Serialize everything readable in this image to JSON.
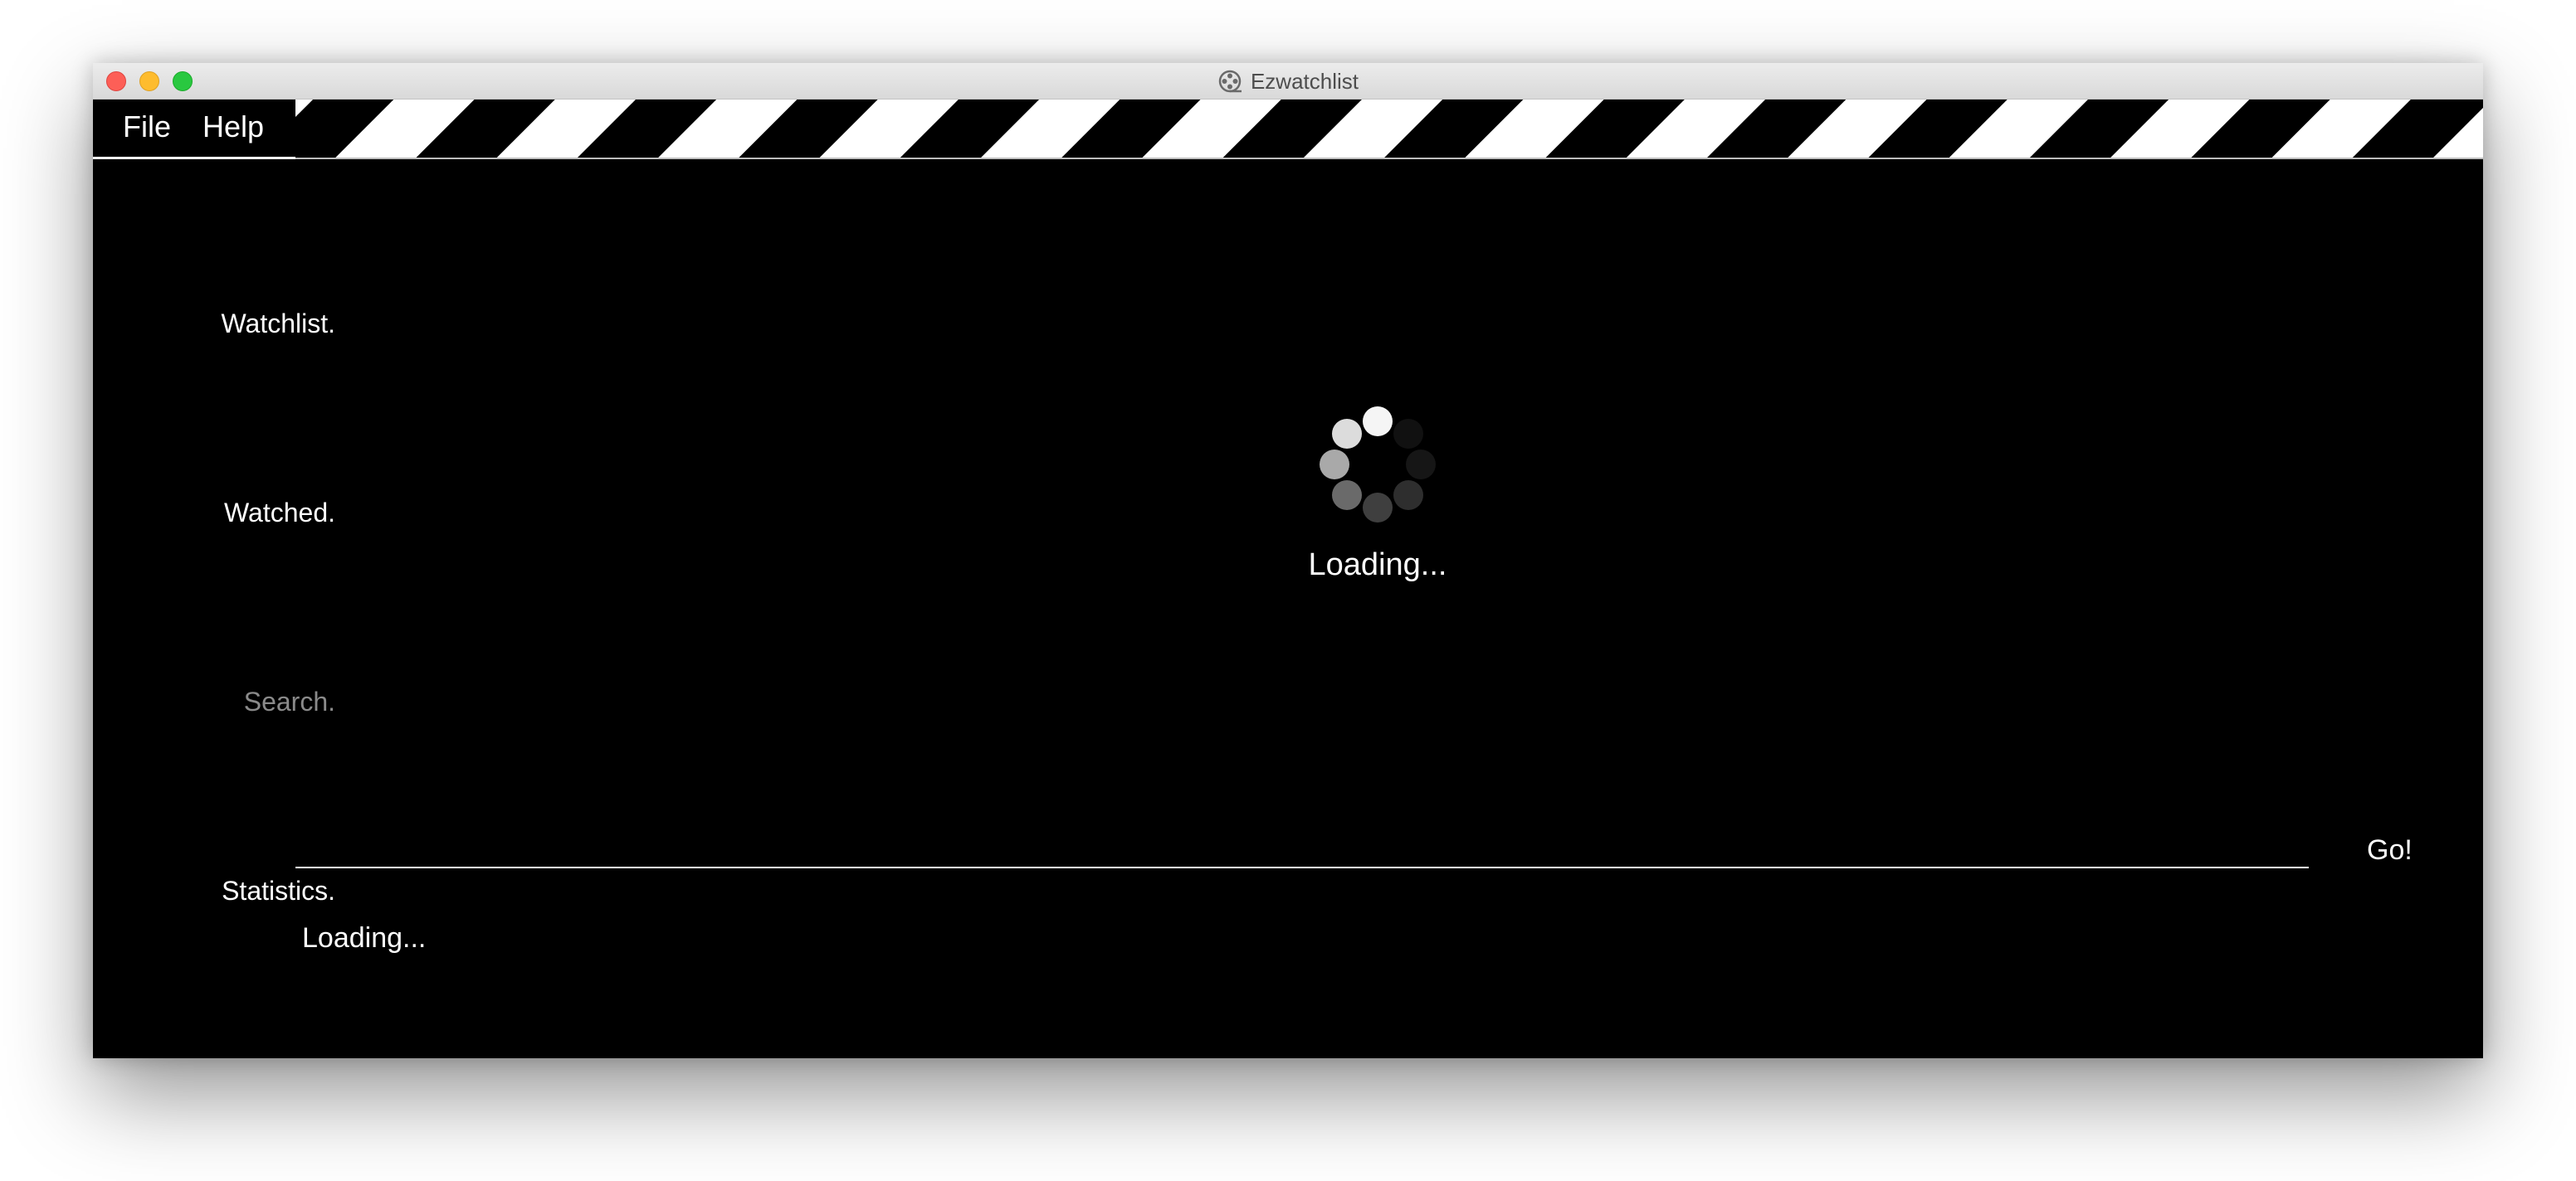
{
  "window": {
    "title": "Ezwatchlist",
    "title_icon": "film-reel-icon"
  },
  "menu": {
    "items": [
      {
        "label": "File"
      },
      {
        "label": "Help"
      }
    ]
  },
  "sidebar": {
    "items": [
      {
        "label": "Watchlist."
      },
      {
        "label": "Watched."
      },
      {
        "label": "Search."
      },
      {
        "label": "Statistics."
      }
    ]
  },
  "main": {
    "loading_label": "Loading...",
    "spinner_icon": "loading-spinner-icon"
  },
  "search": {
    "go_label": "Go!"
  },
  "results": {
    "loading_label": "Loading..."
  },
  "colors": {
    "background": "#000000",
    "foreground": "#ffffff",
    "inactive_text": "#8a8a8a"
  }
}
